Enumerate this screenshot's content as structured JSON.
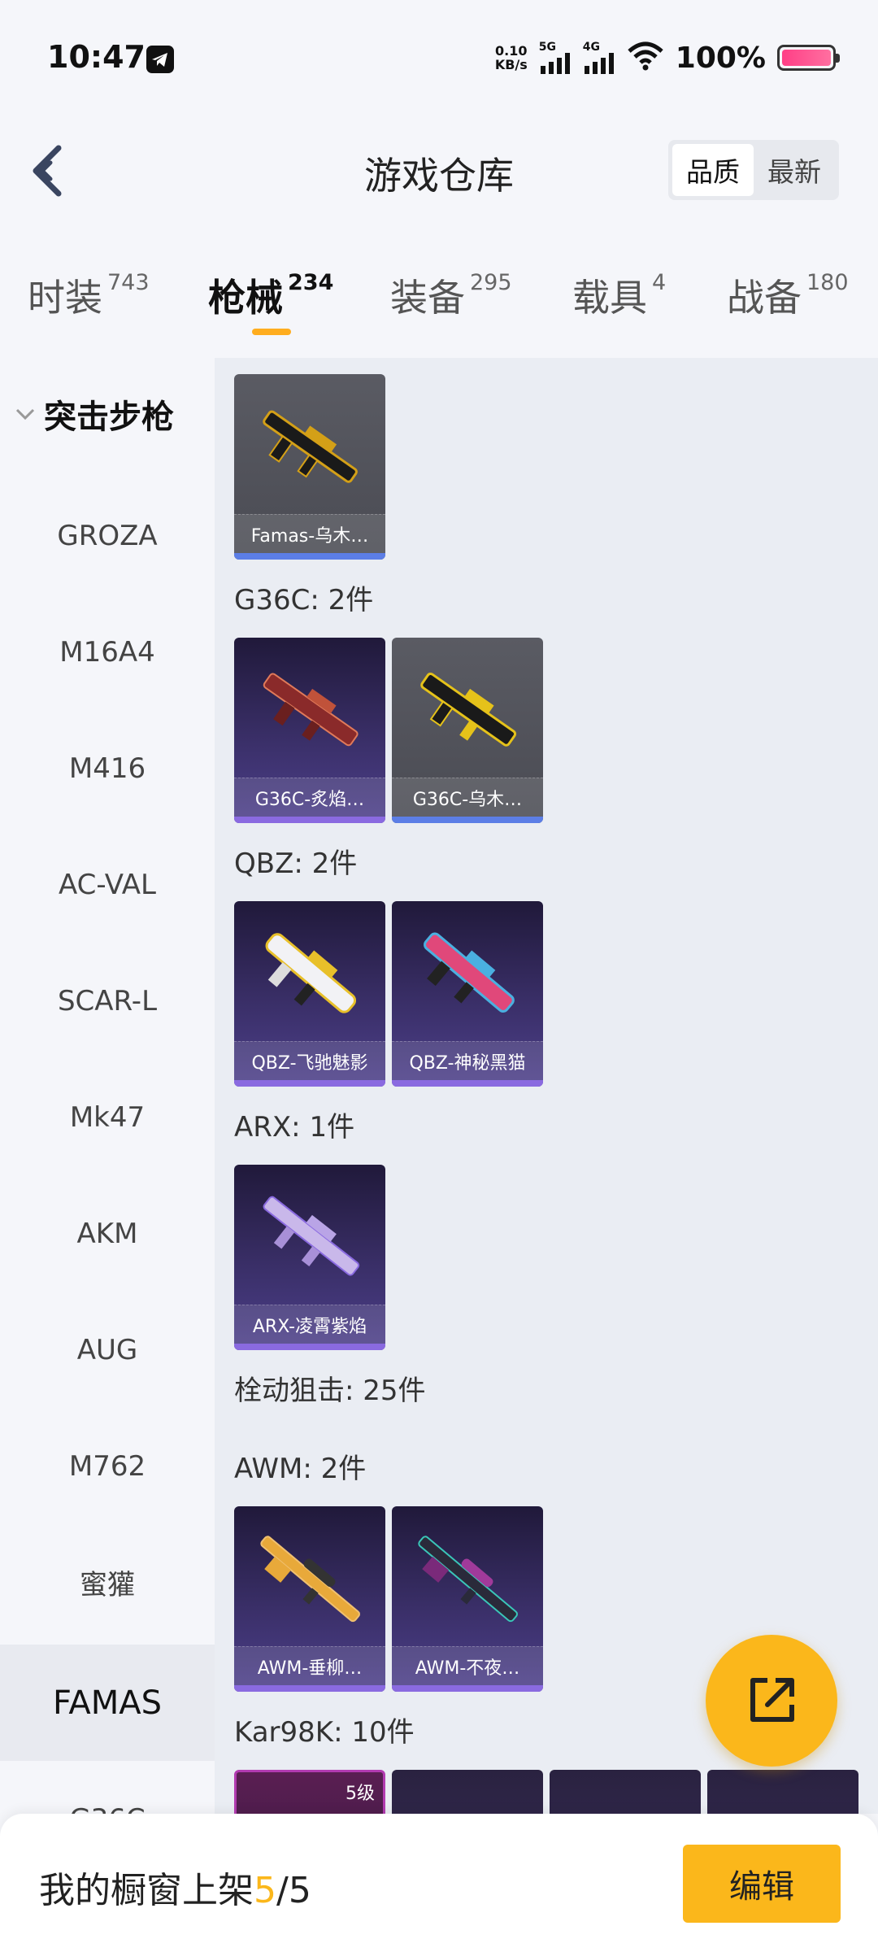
{
  "status": {
    "time": "10:47",
    "net_speed_top": "0.10",
    "net_speed_bottom": "KB/s",
    "sig1": "5G",
    "sig2": "4G",
    "battery": "100%"
  },
  "header": {
    "title": "游戏仓库",
    "sort_options": [
      "品质",
      "最新"
    ]
  },
  "tabs": [
    {
      "label": "时装",
      "count": "743"
    },
    {
      "label": "枪械",
      "count": "234"
    },
    {
      "label": "装备",
      "count": "295"
    },
    {
      "label": "载具",
      "count": "4"
    },
    {
      "label": "战备",
      "count": "180"
    }
  ],
  "sidebar": {
    "group": "突击步枪",
    "items": [
      "GROZA",
      "M16A4",
      "M416",
      "AC-VAL",
      "SCAR-L",
      "Mk47",
      "AKM",
      "AUG",
      "M762",
      "蜜獾",
      "FAMAS",
      "G36C"
    ]
  },
  "content": {
    "famas": {
      "card": "Famas-乌木…"
    },
    "g36c": {
      "label": "G36C: 2件",
      "cards": [
        "G36C-炙焰…",
        "G36C-乌木…"
      ]
    },
    "qbz": {
      "label": "QBZ: 2件",
      "cards": [
        "QBZ-飞驰魅影",
        "QBZ-神秘黑猫"
      ]
    },
    "arx": {
      "label": "ARX: 1件",
      "cards": [
        "ARX-凌霄紫焰"
      ]
    },
    "sniper": {
      "label": "栓动狙击: 25件"
    },
    "awm": {
      "label": "AWM: 2件",
      "cards": [
        "AWM-垂柳…",
        "AWM-不夜…"
      ]
    },
    "kar": {
      "label": "Kar98K: 10件",
      "level": "5级"
    }
  },
  "bottom": {
    "showcase_label": "我的橱窗上架",
    "current": "5",
    "separator": "/",
    "total": "5",
    "edit": "编辑"
  },
  "colors": {
    "accent": "#fbb71b",
    "rare_blue": "#5c7ee6",
    "epic_purple": "#8a6ae0"
  }
}
